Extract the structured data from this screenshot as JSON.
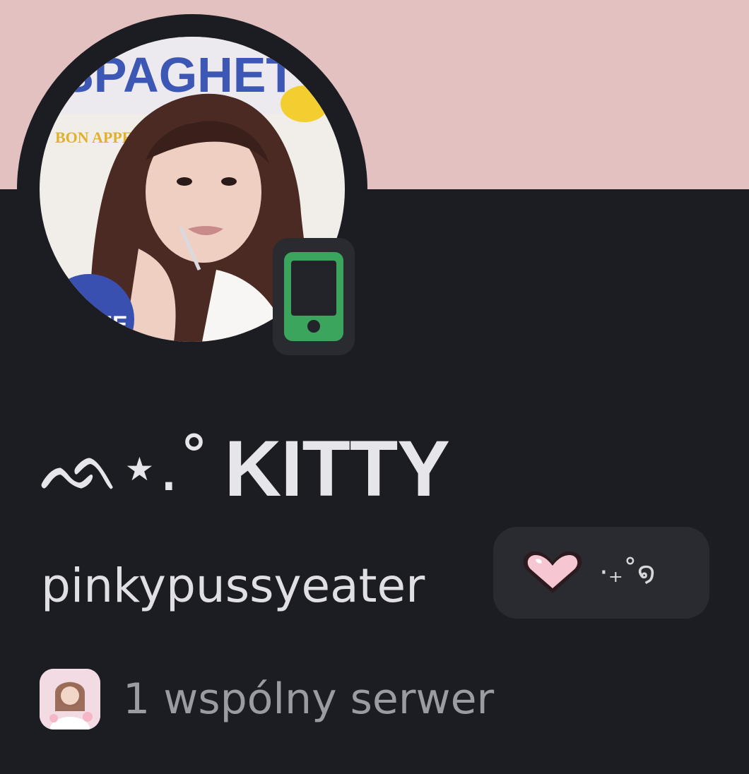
{
  "colors": {
    "banner": "#e3c1c0",
    "background": "#1c1d22",
    "pill": "#2a2b31",
    "status_green": "#3ba55d",
    "text_primary": "#e6e6ea",
    "text_muted": "#9a9ba3"
  },
  "avatar": {
    "cover_title": "SPAGHET",
    "cover_tag": "BON APPETIT",
    "cover_badge": "UE"
  },
  "profile": {
    "display_name_decoration": "ᨒ⋆.˚",
    "display_name": "KITTY",
    "username": "pinkypussyeater",
    "status_icon": "mobile-phone-icon"
  },
  "pronouns": {
    "icon": "pink-heart-icon",
    "text": "⋅₊˚໑"
  },
  "mutual_servers": {
    "icon": "server-avatar-icon",
    "text": "1 wspólny serwer"
  }
}
